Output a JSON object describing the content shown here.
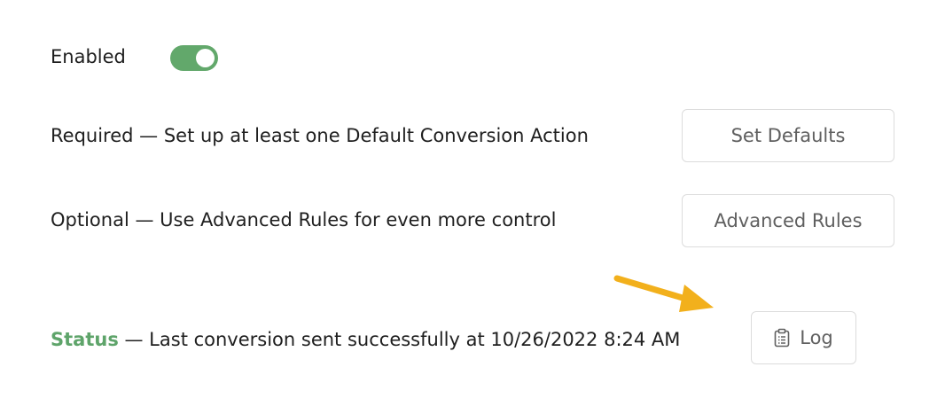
{
  "enabled": {
    "label": "Enabled",
    "state": true
  },
  "required_row": {
    "text": "Required — Set up at least one Default Conversion Action",
    "button_label": "Set Defaults"
  },
  "optional_row": {
    "text": "Optional — Use Advanced Rules for even more control",
    "button_label": "Advanced Rules"
  },
  "status_row": {
    "status_word": "Status",
    "text": " — Last conversion sent successfully at 10/26/2022 8:24 AM",
    "log_button_label": "Log",
    "log_icon": "clipboard-icon"
  },
  "colors": {
    "toggle_on": "#62a86b",
    "status_green": "#5ea46a",
    "arrow": "#f2b01c"
  }
}
